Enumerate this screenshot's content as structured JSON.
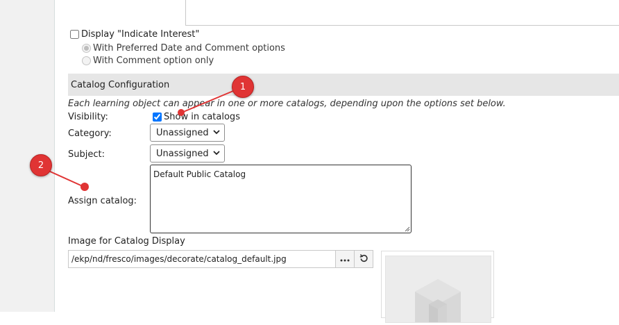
{
  "interest": {
    "display_label": "Display \"Indicate Interest\"",
    "display_checked": false,
    "option1_label": "With Preferred Date and Comment options",
    "option2_label": "With Comment option only"
  },
  "catalog_section": {
    "title": "Catalog Configuration",
    "note": "Each learning object can appear in one or more catalogs, depending upon the options set below.",
    "visibility_label": "Visibility:",
    "show_in_catalogs_label": "Show in catalogs",
    "show_in_catalogs_checked": true,
    "category_label": "Category:",
    "category_value": "Unassigned",
    "subject_label": "Subject:",
    "subject_value": "Unassigned",
    "assign_catalog_label": "Assign catalog:",
    "assign_catalog_value": "Default Public Catalog"
  },
  "image_section": {
    "label": "Image for Catalog Display",
    "path_value": "/ekp/nd/fresco/images/decorate/catalog_default.jpg",
    "browse_icon": "ellipsis-icon",
    "reset_icon": "undo-icon"
  },
  "annotations": {
    "callout1": "1",
    "callout2": "2",
    "color": "#e03434"
  }
}
